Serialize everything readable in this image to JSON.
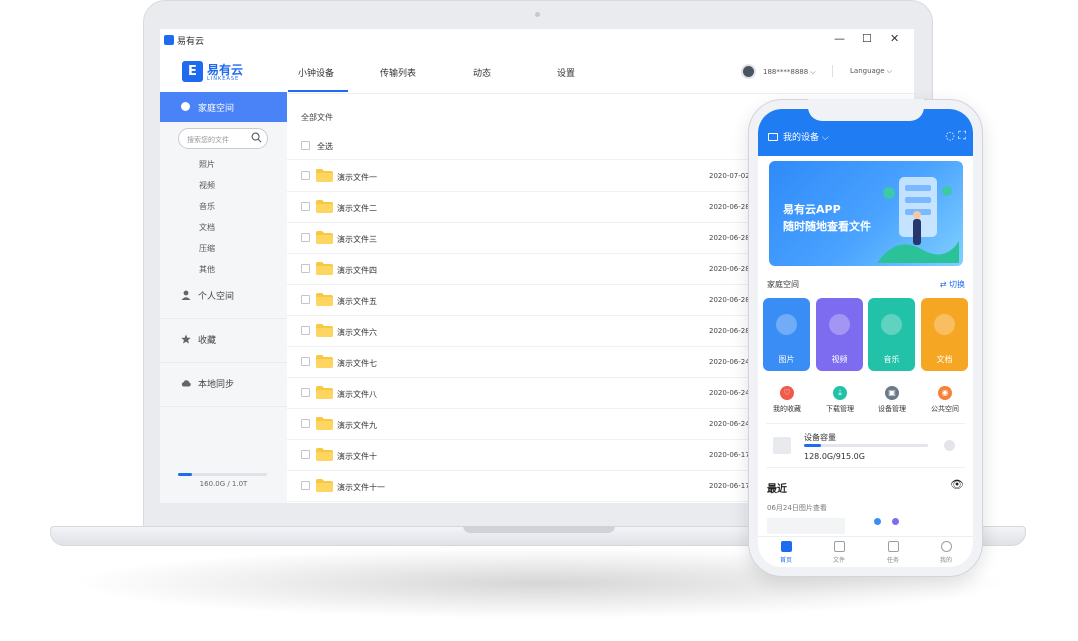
{
  "window": {
    "app_name": "易有云",
    "minimize": "—",
    "maximize": "☐",
    "close": "✕"
  },
  "brand": {
    "logo_mark": "E",
    "name": "易有云",
    "sub": "LINKEASE"
  },
  "nav": {
    "tabs": [
      "小钟设备",
      "传输列表",
      "动态",
      "设置"
    ],
    "active": 0
  },
  "user": {
    "account": "188****8888",
    "caret": "⌵",
    "language": "Language ⌵"
  },
  "sidebar": {
    "active_label": "家庭空间",
    "search_placeholder": "搜索您的文件",
    "categories": [
      "照片",
      "视频",
      "音乐",
      "文档",
      "压缩",
      "其他"
    ],
    "items": [
      "个人空间",
      "收藏",
      "本地同步"
    ],
    "storage": {
      "used_fraction": 0.16,
      "text": "160.0G / 1.0T"
    }
  },
  "content": {
    "breadcrumb": "全部文件",
    "select_all": "全选",
    "rows": [
      {
        "name": "演示文件一",
        "date": "2020-07-02"
      },
      {
        "name": "演示文件二",
        "date": "2020-06-28"
      },
      {
        "name": "演示文件三",
        "date": "2020-06-28"
      },
      {
        "name": "演示文件四",
        "date": "2020-06-28"
      },
      {
        "name": "演示文件五",
        "date": "2020-06-28"
      },
      {
        "name": "演示文件六",
        "date": "2020-06-28"
      },
      {
        "name": "演示文件七",
        "date": "2020-06-24"
      },
      {
        "name": "演示文件八",
        "date": "2020-06-24"
      },
      {
        "name": "演示文件九",
        "date": "2020-06-24"
      },
      {
        "name": "演示文件十",
        "date": "2020-06-17"
      },
      {
        "name": "演示文件十一",
        "date": "2020-06-17"
      }
    ]
  },
  "phone": {
    "device_label": "我的设备",
    "banner": {
      "line1": "易有云APP",
      "line2": "随时随地查看文件"
    },
    "section": "家庭空间",
    "switch_label": "⇄ 切换",
    "tiles": [
      {
        "label": "图片",
        "color": "#3a8df5"
      },
      {
        "label": "视频",
        "color": "#7e6cf0"
      },
      {
        "label": "音乐",
        "color": "#22c2a8"
      },
      {
        "label": "文档",
        "color": "#f5a623"
      }
    ],
    "shortcuts": [
      {
        "label": "我的收藏",
        "color": "#f05a4a",
        "glyph": "♡"
      },
      {
        "label": "下载管理",
        "color": "#22c2a8",
        "glyph": "⤓"
      },
      {
        "label": "设备管理",
        "color": "#6c7a89",
        "glyph": "▣"
      },
      {
        "label": "公共空间",
        "color": "#f5823a",
        "glyph": "◉"
      }
    ],
    "capacity": {
      "title": "设备容量",
      "value": "128.0G/915.0G",
      "used_fraction": 0.14
    },
    "recent": {
      "title": "最近",
      "date_line": "06月24日图片查看"
    },
    "tabbar": [
      "首页",
      "文件",
      "任务",
      "我的"
    ]
  }
}
